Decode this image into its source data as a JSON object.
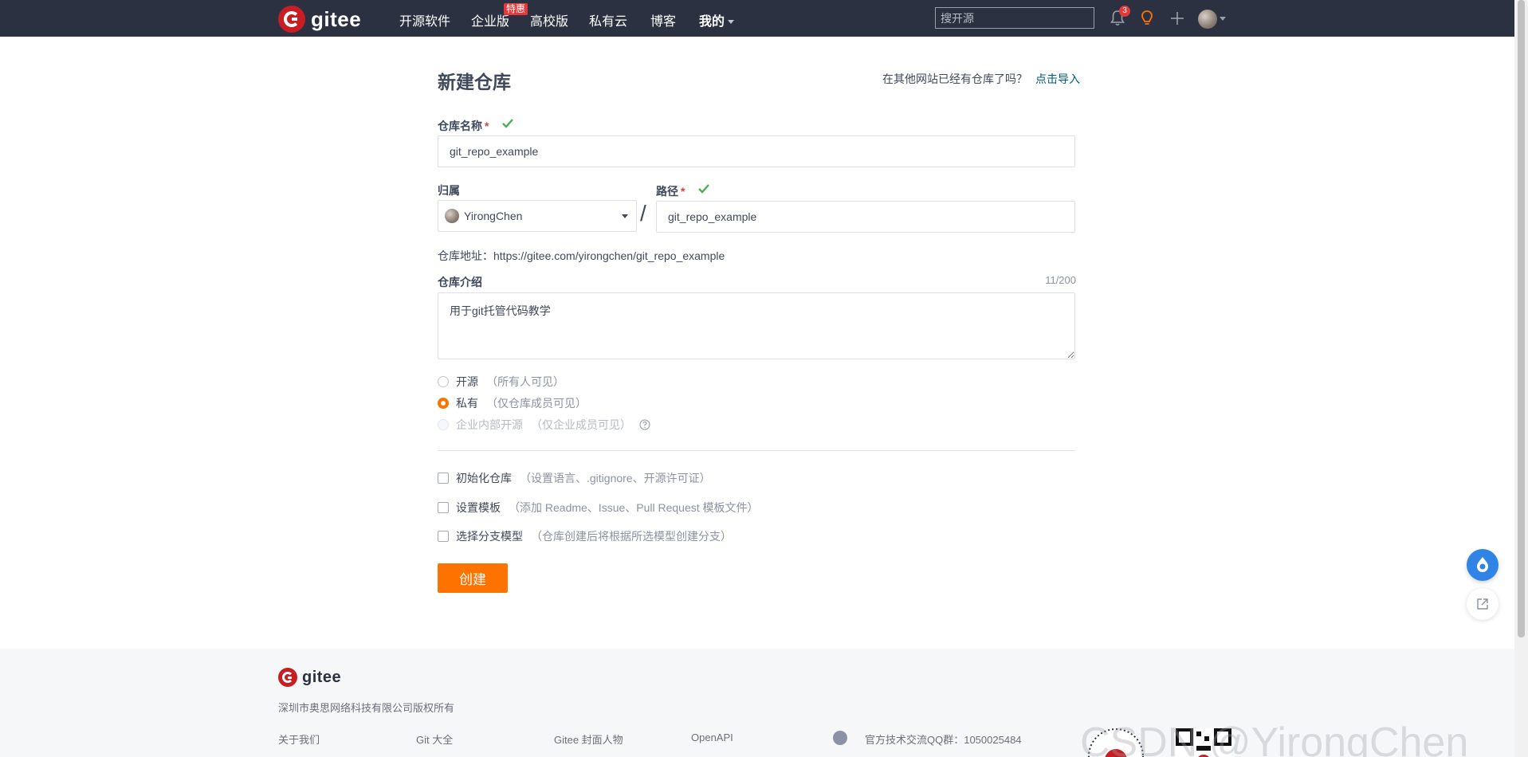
{
  "nav": {
    "logo_text": "gitee",
    "items": [
      {
        "label": "开源软件"
      },
      {
        "label": "企业版"
      },
      {
        "label": "高校版"
      },
      {
        "label": "私有云"
      },
      {
        "label": "博客"
      },
      {
        "label": "我的"
      }
    ],
    "badge": "特惠",
    "search_placeholder": "搜开源",
    "notification_count": "3"
  },
  "form": {
    "title": "新建仓库",
    "import_prompt": "在其他网站已经有仓库了吗？",
    "import_link": "点击导入",
    "name_label": "仓库名称",
    "required_mark": "*",
    "name_value": "git_repo_example",
    "owner_label": "归属",
    "owner_value": "YirongChen",
    "separator": "/",
    "path_label": "路径",
    "path_value": "git_repo_example",
    "url_label": "仓库地址：",
    "url_value": "https://gitee.com/yirongchen/git_repo_example",
    "desc_label": "仓库介绍",
    "desc_count": "11/200",
    "desc_value": "用于git托管代码教学",
    "visibility": [
      {
        "label": "开源",
        "desc": "（所有人可见）",
        "state": "unchecked"
      },
      {
        "label": "私有",
        "desc": "（仅仓库成员可见）",
        "state": "checked"
      },
      {
        "label": "企业内部开源",
        "desc": "（仅企业成员可见）",
        "state": "disabled"
      }
    ],
    "options": [
      {
        "label": "初始化仓库",
        "desc": "（设置语言、.gitignore、开源许可证）"
      },
      {
        "label": "设置模板",
        "desc": "（添加 Readme、Issue、Pull Request 模板文件）"
      },
      {
        "label": "选择分支模型",
        "desc": "（仓库创建后将根据所选模型创建分支）"
      }
    ],
    "submit_label": "创建"
  },
  "footer": {
    "logo_text": "gitee",
    "copyright": "深圳市奥思网络科技有限公司版权所有",
    "links": [
      "关于我们",
      "Git 大全",
      "Gitee 封面人物",
      "OpenAPI"
    ],
    "qq_group": "官方技术交流QQ群：1050025484",
    "watermark": "CSDN @YirongChen"
  },
  "colors": {
    "nav_bg": "#2b3140",
    "accent": "#fe7300",
    "brand_red": "#c71d23",
    "link": "#005980",
    "success": "#4caf50"
  }
}
